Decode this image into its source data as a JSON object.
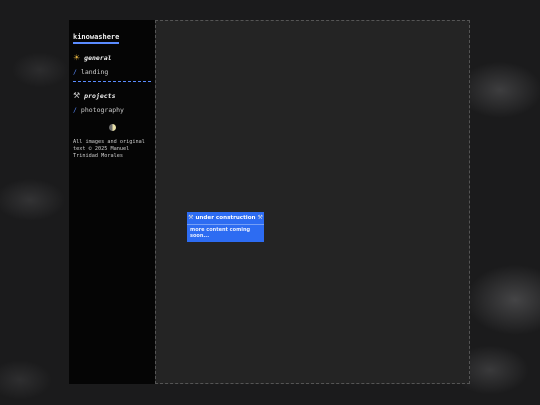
{
  "site": {
    "title": "kinowashere"
  },
  "nav": {
    "general": {
      "icon": "sun-icon",
      "heading": "general",
      "links": [
        {
          "slash": "/",
          "label": "landing"
        }
      ]
    },
    "projects": {
      "icon": "hammer-wrench-icon",
      "heading": "projects",
      "links": [
        {
          "slash": "/",
          "label": "photography"
        }
      ]
    }
  },
  "icons": {
    "general": "☀",
    "projects": "⚒",
    "notice_tool": "⚒"
  },
  "footer": {
    "text": "All images and original text © 2025 Manuel Trinidad Morales"
  },
  "notice": {
    "title": "under construction",
    "subtitle": "more content coming soon..."
  },
  "colors": {
    "accent": "#5b8cff",
    "notice_bg": "#2d6cf2",
    "sidebar_bg": "#050505",
    "main_bg": "#242424"
  }
}
